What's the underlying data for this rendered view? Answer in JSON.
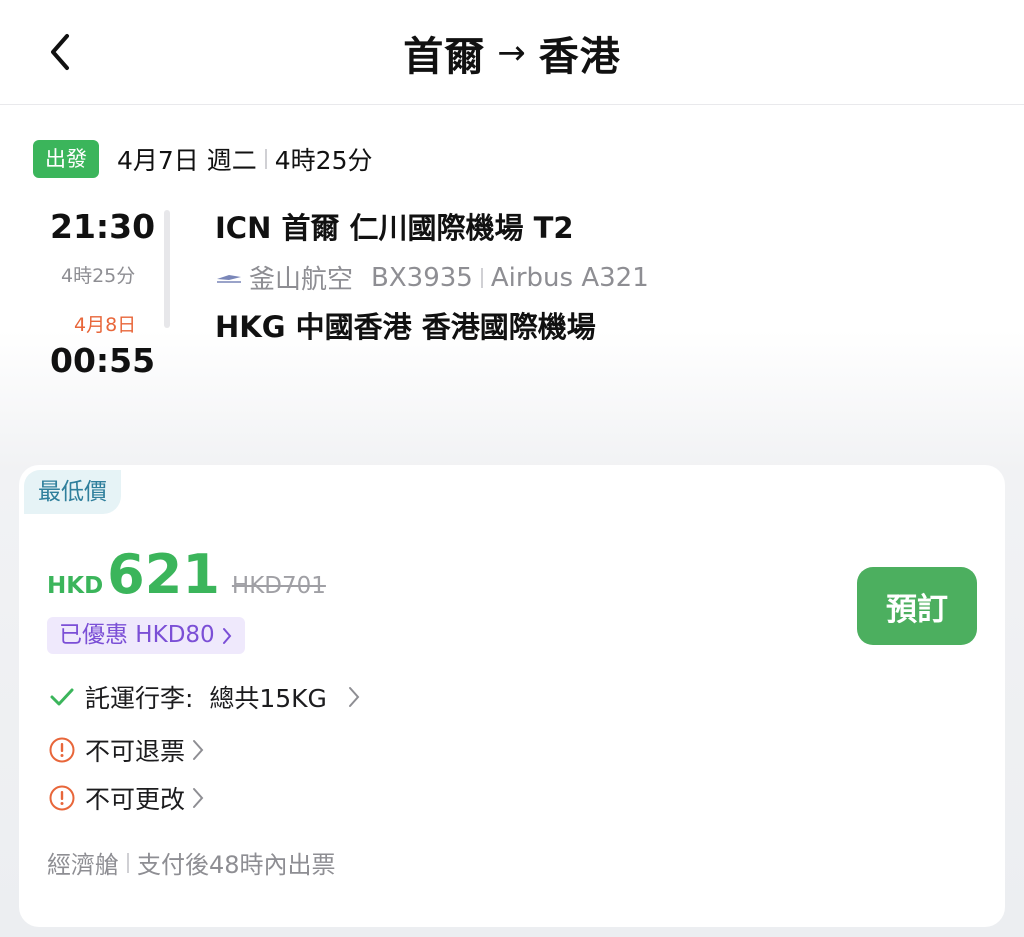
{
  "header": {
    "origin": "首爾",
    "arrow": "→",
    "destination": "香港"
  },
  "departure": {
    "badge": "出發",
    "date": "4月7日 週二",
    "duration": "4時25分"
  },
  "flight": {
    "dep_time": "21:30",
    "mid_duration": "4時25分",
    "arr_date": "4月8日",
    "arr_time": "00:55",
    "dep_airport": "ICN 首爾 仁川國際機場 T2",
    "airline": "釜山航空",
    "flight_no": "BX3935",
    "aircraft": "Airbus A321",
    "arr_airport": "HKG 中國香港 香港國際機場"
  },
  "offer": {
    "badge": "最低價",
    "currency": "HKD",
    "price": "621",
    "original_price": "HKD701",
    "discount": "已優惠 HKD80",
    "book_label": "預訂",
    "baggage": "託運行李:  總共15KG",
    "refund": "不可退票",
    "change": "不可更改",
    "cabin": "經濟艙",
    "ticketing": "支付後48時內出票"
  },
  "colors": {
    "green": "#3bb55b",
    "orange": "#e8663a",
    "purple": "#7b4fd6"
  }
}
